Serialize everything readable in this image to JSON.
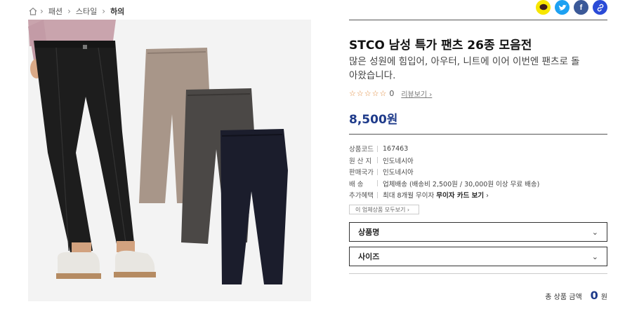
{
  "breadcrumb": {
    "items": [
      "패션",
      "스타일",
      "하의"
    ]
  },
  "share": {
    "buttons": [
      {
        "name": "kakaotalk",
        "color": "#f7e600"
      },
      {
        "name": "twitter",
        "color": "#1da1f2"
      },
      {
        "name": "facebook",
        "color": "#3b5998"
      },
      {
        "name": "link",
        "color": "#2a4bd7"
      }
    ]
  },
  "product": {
    "title": "STCO 남성 특가 팬츠 26종 모음전",
    "subtitle": "많은 성원에 힘입어, 아우터, 니트에 이어 이번엔 팬츠로 돌아왔습니다.",
    "stars": "☆☆☆☆☆",
    "rating_count": "0",
    "review_link": "리뷰보기",
    "price": "8,500원"
  },
  "info": {
    "rows": [
      {
        "label": "상품코드",
        "value": "167463"
      },
      {
        "label": "원 산 지",
        "value": "인도네시아"
      },
      {
        "label": "판매국가",
        "value": "인도네시아"
      },
      {
        "label": "배 송",
        "value": "업체배송 (배송비 2,500원 / 30,000원 이상 무료 배송)"
      },
      {
        "label": "추가혜택",
        "value": "최대 8개월 무이자",
        "value_bold": "무이자 카드 보기"
      }
    ],
    "seller_button": "이 업체상품 모두보기"
  },
  "options": [
    {
      "label": "상품명"
    },
    {
      "label": "사이즈"
    }
  ],
  "total": {
    "label": "총 상품 금액",
    "amount": "0",
    "unit": "원"
  },
  "colors": {
    "price": "#1e3a8a",
    "star": "#e08a3c"
  }
}
